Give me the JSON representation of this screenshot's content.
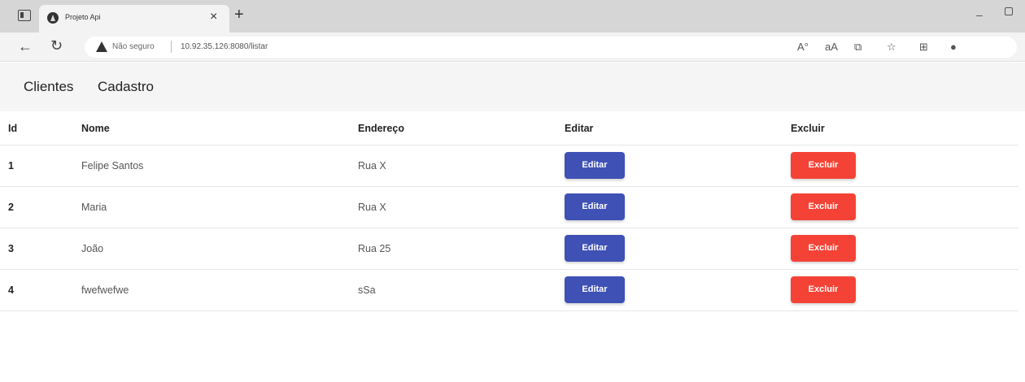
{
  "browser": {
    "tab_title": "Projeto Api",
    "tab_close": "×",
    "new_tab": "+",
    "minimize": "–",
    "security_label": "Não seguro",
    "url": "10.92.35.126:8080/listar"
  },
  "nav": {
    "clientes": "Clientes",
    "cadastro": "Cadastro"
  },
  "table": {
    "headers": {
      "id": "Id",
      "nome": "Nome",
      "endereco": "Endereço",
      "editar": "Editar",
      "excluir": "Excluir"
    },
    "rows": [
      {
        "id": "1",
        "nome": "Felipe Santos",
        "endereco": "Rua X",
        "edit_label": "Editar",
        "delete_label": "Excluir"
      },
      {
        "id": "2",
        "nome": "Maria",
        "endereco": "Rua X",
        "edit_label": "Editar",
        "delete_label": "Excluir"
      },
      {
        "id": "3",
        "nome": "João",
        "endereco": "Rua 25",
        "edit_label": "Editar",
        "delete_label": "Excluir"
      },
      {
        "id": "4",
        "nome": "fwefwefwe",
        "endereco": "sSa",
        "edit_label": "Editar",
        "delete_label": "Excluir"
      }
    ]
  },
  "colors": {
    "edit_button": "#3f51b5",
    "delete_button": "#f44336",
    "appbar": "#f5f5f5"
  },
  "icons": [
    "tab-actions-icon",
    "app-favicon-icon",
    "close-icon",
    "plus-icon",
    "back-arrow-icon",
    "reload-icon",
    "warning-icon",
    "read-aloud-icon",
    "font-size-icon",
    "extensions-icon",
    "favorites-star-icon",
    "collections-icon",
    "profile-avatar-icon"
  ]
}
